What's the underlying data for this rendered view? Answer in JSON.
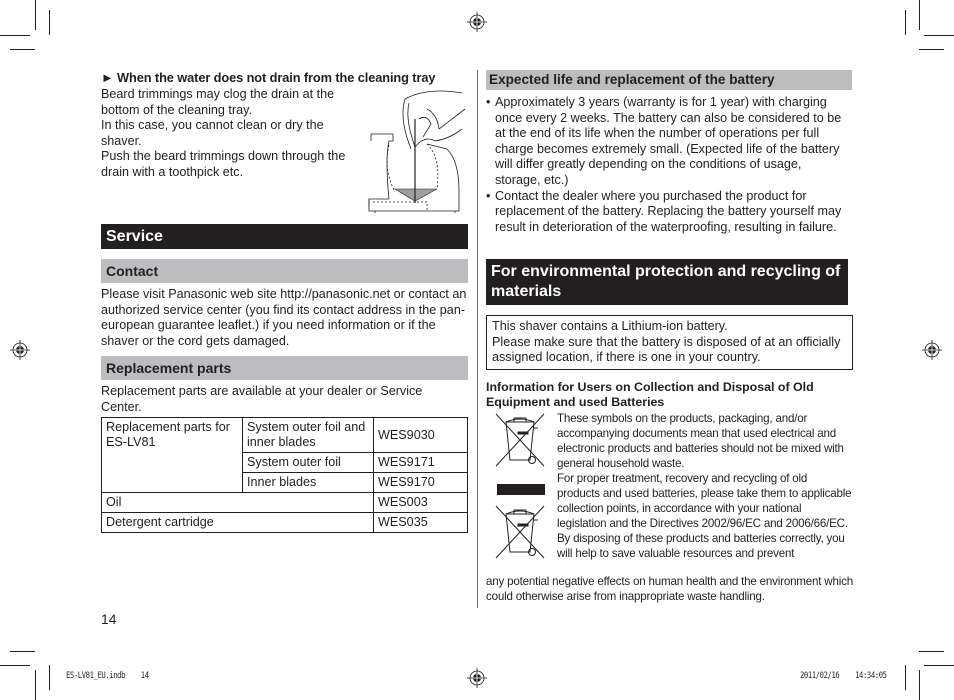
{
  "left": {
    "cleaning_tray": {
      "heading_marker": "►",
      "heading": "When the water does not drain from the cleaning tray",
      "lines": [
        "Beard trimmings may clog the drain at the",
        "bottom of the cleaning tray.",
        "In this case, you cannot clean or dry the",
        "shaver.",
        "Push the beard trimmings down through the",
        "drain with a toothpick etc."
      ]
    },
    "service": {
      "title": "Service",
      "contact": {
        "title": "Contact",
        "text": "Please visit Panasonic web site http://panasonic.net or contact an authorized service center (you find its contact address in the pan-european guarantee leaflet.) if you need information or if the shaver or the cord gets damaged."
      },
      "replacement_parts": {
        "title": "Replacement parts",
        "text": "Replacement parts are available at your dealer or Service Center.",
        "table": {
          "group_label": "Replacement parts for ES-LV81",
          "group_rows": [
            {
              "part": "System outer foil and inner blades",
              "code": "WES9030"
            },
            {
              "part": "System outer foil",
              "code": "WES9171"
            },
            {
              "part": "Inner blades",
              "code": "WES9170"
            }
          ],
          "rows": [
            {
              "part": "Oil",
              "code": "WES003"
            },
            {
              "part": "Detergent cartridge",
              "code": "WES035"
            }
          ]
        }
      }
    },
    "page_number": "14"
  },
  "right": {
    "battery": {
      "title": "Expected life and replacement of the battery",
      "bullet": "•",
      "bullets": [
        "Approximately 3 years (warranty is for 1 year) with charging once every 2 weeks. The battery can also be considered to be at the end of its life when the number of operations per full charge becomes extremely small. (Expected life of the battery will differ greatly depending on the conditions of usage, storage, etc.)",
        "Contact the dealer where you purchased the product for replacement of the battery. Replacing the battery yourself may result in deterioration of the waterproofing, resulting in failure."
      ]
    },
    "environment": {
      "title": "For environmental protection and recycling of materials",
      "box_lines": [
        "This shaver contains a Lithium-ion battery.",
        "Please make sure that the battery is disposed of at an officially assigned location, if there is one in your country."
      ],
      "info_title": "Information for Users on Collection and Disposal of Old Equipment and used Batteries",
      "paragraphs": [
        "These symbols on the products, packaging, and/or accompanying documents mean that used electrical and electronic products and batteries should not be mixed with general household waste.",
        "For proper treatment, recovery and recycling of old products and used batteries, please take them to applicable collection points, in accordance with your national legislation and the Directives 2002/96/EC and 2006/66/EC.",
        "By disposing of these products and batteries correctly, you will help to save valuable resources and prevent"
      ],
      "tail": "any potential negative effects on human health and the environment which could otherwise arise from inappropriate waste handling.",
      "icons": [
        "crossed-out-wheelie-bin-icon",
        "black-bar-icon",
        "crossed-out-wheelie-bin-icon"
      ]
    }
  },
  "slug": {
    "file": "ES-LV81_EU.indb",
    "page": "14",
    "date": "2011/02/16",
    "time": "14:34:05"
  },
  "colors": {
    "ink": "#231f20",
    "gray_bar": "#bcbdc0"
  }
}
